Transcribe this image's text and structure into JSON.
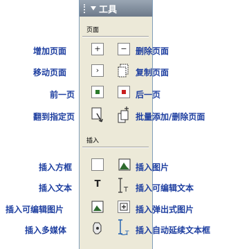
{
  "panel": {
    "title": "工具",
    "page_section": "页面",
    "insert_section": "插入"
  },
  "labels": {
    "add_page": "增加页面",
    "delete_page": "删除页面",
    "move_page": "移动页面",
    "copy_page": "复制页面",
    "prev_page": "前一页",
    "next_page": "后一页",
    "goto_page": "翻到指定页",
    "batch_pages": "批量添加/删除页面",
    "insert_box": "插入方框",
    "insert_image": "插入图片",
    "insert_text": "插入文本",
    "insert_editable_text": "插入可编辑文本",
    "insert_editable_image": "插入可编辑图片",
    "insert_popup_image": "插入弹出式图片",
    "insert_media": "插入多媒体",
    "insert_autoflow_text": "插入自动延续文本框"
  },
  "glyphs": {
    "plus": "+",
    "minus": "−",
    "arrow": "›",
    "text_t": "T"
  }
}
